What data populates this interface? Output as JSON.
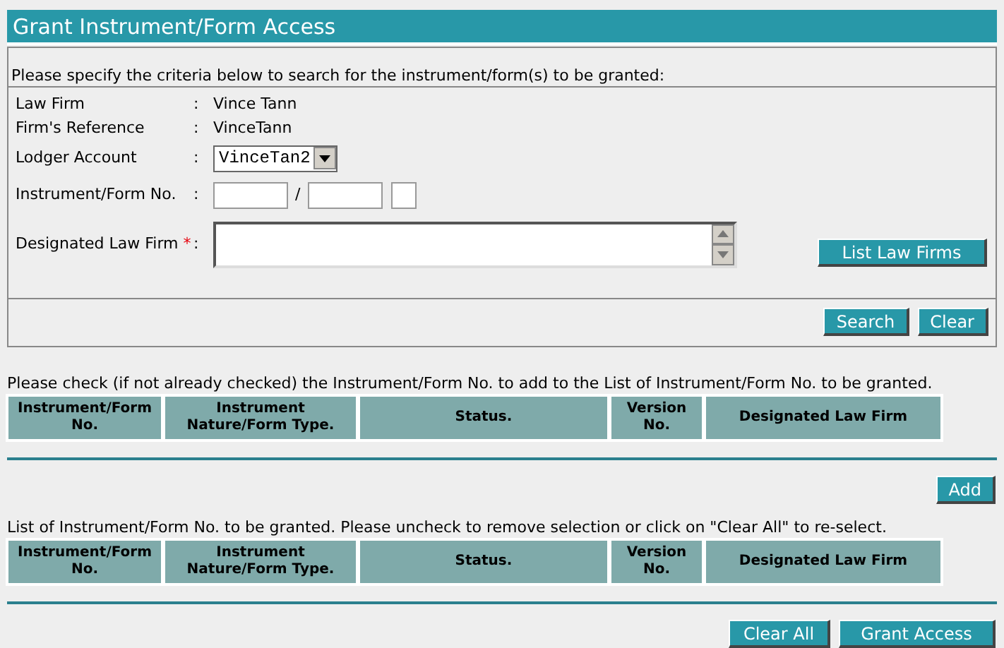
{
  "title": "Grant Instrument/Form Access",
  "intro": "Please specify the criteria below to search for the instrument/form(s) to be granted:",
  "fields": [
    {
      "kind": "text",
      "label": "Law Firm",
      "colon": ":",
      "value": "Vince Tann"
    },
    {
      "kind": "text",
      "label": "Firm's Reference",
      "colon": ":",
      "value": "VinceTann"
    },
    {
      "kind": "select",
      "label": "Lodger Account",
      "colon": ":",
      "value": "VinceTan2"
    },
    {
      "kind": "instrument",
      "label": "Instrument/Form No.",
      "colon": ":",
      "separator": "/"
    },
    {
      "kind": "textarea",
      "label": "Designated Law Firm",
      "required_mark": "*",
      "colon": ":",
      "button": "List Law Firms"
    }
  ],
  "search_buttons": [
    "Search",
    "Clear"
  ],
  "sections": [
    {
      "instruction": "Please check (if not already checked) the Instrument/Form No. to add to the List of Instrument/Form No. to be granted.",
      "columns": [
        "Instrument/Form No.",
        "Instrument Nature/Form Type.",
        "Status.",
        "Version No.",
        "Designated Law Firm"
      ],
      "buttons": [
        "Add"
      ]
    },
    {
      "instruction": "List of Instrument/Form No. to be granted. Please uncheck to remove selection or click on \"Clear All\" to re-select.",
      "columns": [
        "Instrument/Form No.",
        "Instrument Nature/Form Type.",
        "Status.",
        "Version No.",
        "Designated Law Firm"
      ],
      "buttons": [
        "Clear All",
        "Grant Access"
      ]
    }
  ]
}
